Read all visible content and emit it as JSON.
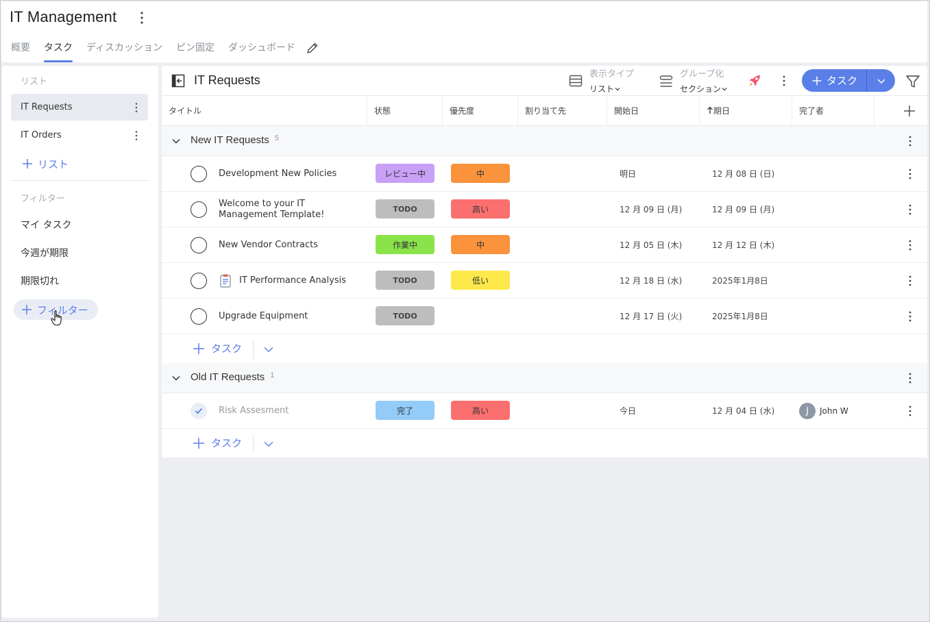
{
  "app": {
    "title": "IT Management",
    "tabs": [
      {
        "label": "概要"
      },
      {
        "label": "タスク"
      },
      {
        "label": "ディスカッション"
      },
      {
        "label": "ピン固定"
      },
      {
        "label": "ダッシュボード"
      }
    ],
    "active_tab": "タスク"
  },
  "sidebar": {
    "lists_heading": "リスト",
    "lists": [
      {
        "label": "IT Requests",
        "active": true
      },
      {
        "label": "IT Orders",
        "active": false
      }
    ],
    "add_list_label": "リスト",
    "filters_heading": "フィルター",
    "filters": [
      {
        "label": "マイ タスク"
      },
      {
        "label": "今週が期限"
      },
      {
        "label": "期限切れ"
      }
    ],
    "add_filter_label": "フィルター"
  },
  "toolbar": {
    "list_title": "IT Requests",
    "view_type_label": "表示タイプ",
    "view_type_value": "リスト",
    "group_by_label": "グループ化",
    "group_by_value": "セクション",
    "add_task_label": "タスク"
  },
  "columns": {
    "title": "タイトル",
    "status": "状態",
    "priority": "優先度",
    "assignee": "割り当て先",
    "start": "開始日",
    "due": "期日",
    "done_by": "完了者"
  },
  "sections": [
    {
      "name": "New IT Requests",
      "count": "5",
      "add_task_label": "タスク",
      "tasks": [
        {
          "title": "Development New Policies",
          "status": "レビュー中",
          "status_color": "#c9a0f7",
          "priority": "中",
          "priority_color": "#fb923c",
          "start": "明日",
          "due": "12 月 08 日 (日)",
          "done_by": "",
          "has_doc_icon": false
        },
        {
          "title": "Welcome to your IT Management Template!",
          "status": "TODO",
          "status_color": "#bdbdbd",
          "priority": "高い",
          "priority_color": "#fb6f6f",
          "start": "12 月 09 日 (月)",
          "due": "12 月 09 日 (月)",
          "done_by": "",
          "has_doc_icon": false
        },
        {
          "title": "New Vendor Contracts",
          "status": "作業中",
          "status_color": "#8ae34a",
          "priority": "中",
          "priority_color": "#fb923c",
          "start": "12 月 05 日 (木)",
          "due": "12 月 12 日 (木)",
          "done_by": "",
          "has_doc_icon": false
        },
        {
          "title": "IT Performance Analysis",
          "status": "TODO",
          "status_color": "#bdbdbd",
          "priority": "低い",
          "priority_color": "#fdea4a",
          "start": "12 月 18 日 (水)",
          "due": "2025年1月8日",
          "done_by": "",
          "has_doc_icon": true
        },
        {
          "title": "Upgrade Equipment",
          "status": "TODO",
          "status_color": "#bdbdbd",
          "priority": "",
          "priority_color": "",
          "start": "12 月 17 日 (火)",
          "due": "2025年1月8日",
          "done_by": "",
          "has_doc_icon": false
        }
      ]
    },
    {
      "name": "Old IT Requests",
      "count": "1",
      "add_task_label": "タスク",
      "tasks": [
        {
          "title": "Risk Assesment",
          "status": "完了",
          "status_color": "#93cbf9",
          "priority": "高い",
          "priority_color": "#fb6f6f",
          "start": "今日",
          "due": "12 月 04 日 (水)",
          "done_by": "John W",
          "done_by_initial": "J",
          "completed": true,
          "has_doc_icon": false
        }
      ]
    }
  ],
  "colors": {
    "accent": "#5b7fe8"
  }
}
